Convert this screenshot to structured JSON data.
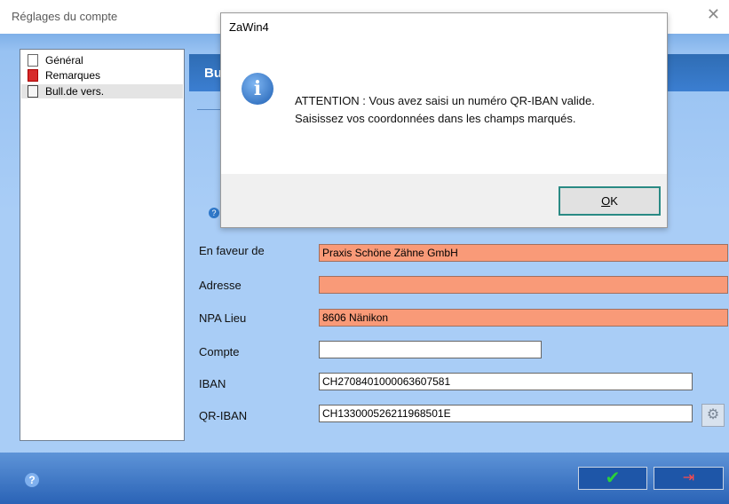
{
  "window": {
    "title": "Réglages du compte",
    "close_icon": "close-icon"
  },
  "tree": {
    "items": [
      {
        "label": "Général",
        "icon": "document-icon"
      },
      {
        "label": "Remarques",
        "icon": "remark-icon"
      },
      {
        "label": "Bull.de vers.",
        "icon": "payment-slip-icon"
      }
    ]
  },
  "section": {
    "title": "Bu"
  },
  "form": {
    "en_faveur_label": "En faveur de",
    "en_faveur_value": "Praxis Schöne Zähne GmbH",
    "adresse_label": "Adresse",
    "adresse_value": "",
    "npa_label": "NPA Lieu",
    "npa_value": "8606 Nänikon",
    "compte_label": "Compte",
    "compte_value": "",
    "iban_label": "IBAN",
    "iban_value": "CH2708401000063607581",
    "qr_iban_label": "QR-IBAN",
    "qr_iban_value": "CH133000526211968501E"
  },
  "colors": {
    "marked_field": "#f99a78",
    "header_blue": "#3b7ed1",
    "ok_check": "#2ad13a"
  },
  "dialog": {
    "title": "ZaWin4",
    "line1": "ATTENTION : Vous avez saisi un numéro QR-IBAN valide.",
    "line2": "Saisissez vos coordonnées dans les champs marqués.",
    "ok_label_first": "O",
    "ok_label_rest": "K",
    "icon": "info-icon"
  },
  "bottom": {
    "ok_icon": "check-icon",
    "exit_icon": "exit-icon",
    "help_icon": "help-icon"
  }
}
